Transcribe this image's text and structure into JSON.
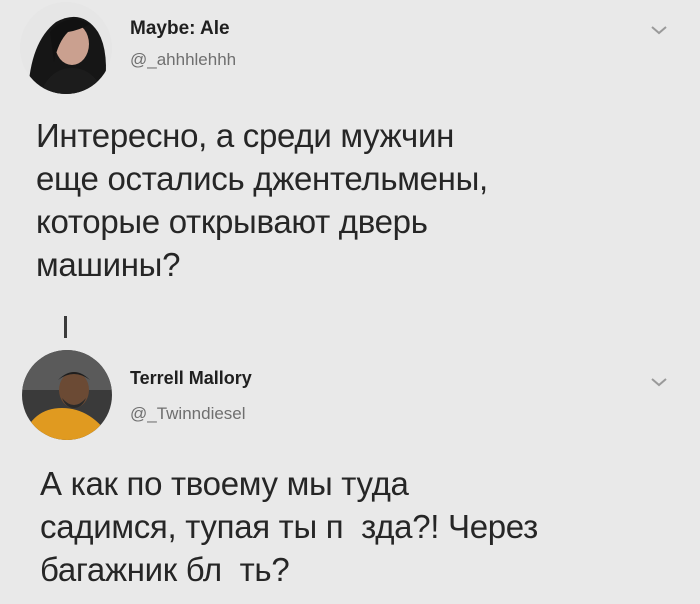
{
  "tweet1": {
    "name": "Maybe: Ale",
    "handle": "@_ahhhlehhh",
    "text_lines": [
      "Интересно, а среди мужчин",
      "еще остались джентельмены,",
      "которые открывают дверь",
      "машины?"
    ]
  },
  "tweet2": {
    "name": "Terrell Mallory",
    "handle": "@_Twinndiesel",
    "text_lines": [
      "А как по твоему мы туда",
      "садимся, тупая ты п  зда?! Через",
      "багажник бл  ть?"
    ]
  }
}
